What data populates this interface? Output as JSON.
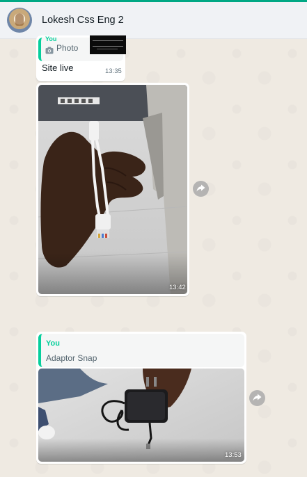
{
  "header": {
    "chat_name": "Lokesh Css Eng 2"
  },
  "messages": [
    {
      "quote_sender": "You",
      "quote_label": "Photo",
      "text": "Site live",
      "time": "13:35"
    },
    {
      "image_desc_icon": "poe-adapter-photo",
      "time": "13:42"
    },
    {
      "quote_sender": "You",
      "quote_text": "Adaptor Snap",
      "time": "13:53"
    }
  ],
  "colors": {
    "accent": "#00a884",
    "quote_bar": "#06cf9c",
    "header_bg": "#f0f2f5",
    "chat_bg": "#efeae2",
    "bubble_bg": "#ffffff"
  }
}
